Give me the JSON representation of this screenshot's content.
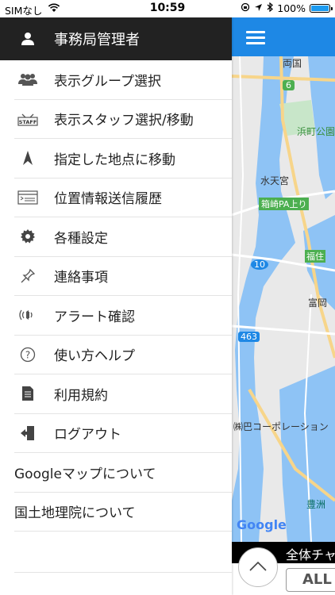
{
  "status_bar": {
    "carrier": "SIMなし",
    "time": "10:59",
    "battery": "100%",
    "battery_level": 1.0
  },
  "drawer": {
    "header": {
      "label": "事務局管理者",
      "icon": "person-icon"
    },
    "items": [
      {
        "label": "表示グループ選択",
        "icon": "group-icon"
      },
      {
        "label": "表示スタッフ選択/移動",
        "icon": "staff-icon",
        "icon_text": "STAFF"
      },
      {
        "label": "指定した地点に移動",
        "icon": "navigation-arrow-icon"
      },
      {
        "label": "位置情報送信履歴",
        "icon": "history-list-icon"
      },
      {
        "label": "各種設定",
        "icon": "gear-icon"
      },
      {
        "label": "連絡事項",
        "icon": "pin-icon"
      },
      {
        "label": "アラート確認",
        "icon": "alert-sound-icon"
      },
      {
        "label": "使い方ヘルプ",
        "icon": "help-icon"
      },
      {
        "label": "利用規約",
        "icon": "document-icon"
      },
      {
        "label": "ログアウト",
        "icon": "logout-icon"
      }
    ],
    "text_items": [
      {
        "label": "Googleマップについて"
      },
      {
        "label": "国土地理院について"
      }
    ]
  },
  "map": {
    "labels": {
      "ryogoku": "両国",
      "route6": "6",
      "hamacho": "浜町公園",
      "suitengu": "水天宮",
      "hakozaki": "箱崎PA上り",
      "route10": "10",
      "fukuzumi": "福住",
      "tomioka": "富岡",
      "route463": "463",
      "corp": "㈱巴コーポレーション",
      "toyosu": "豊洲"
    },
    "google_logo": "Google"
  },
  "bottom": {
    "channel_text": "全体チャ",
    "all_button": "ALL"
  }
}
